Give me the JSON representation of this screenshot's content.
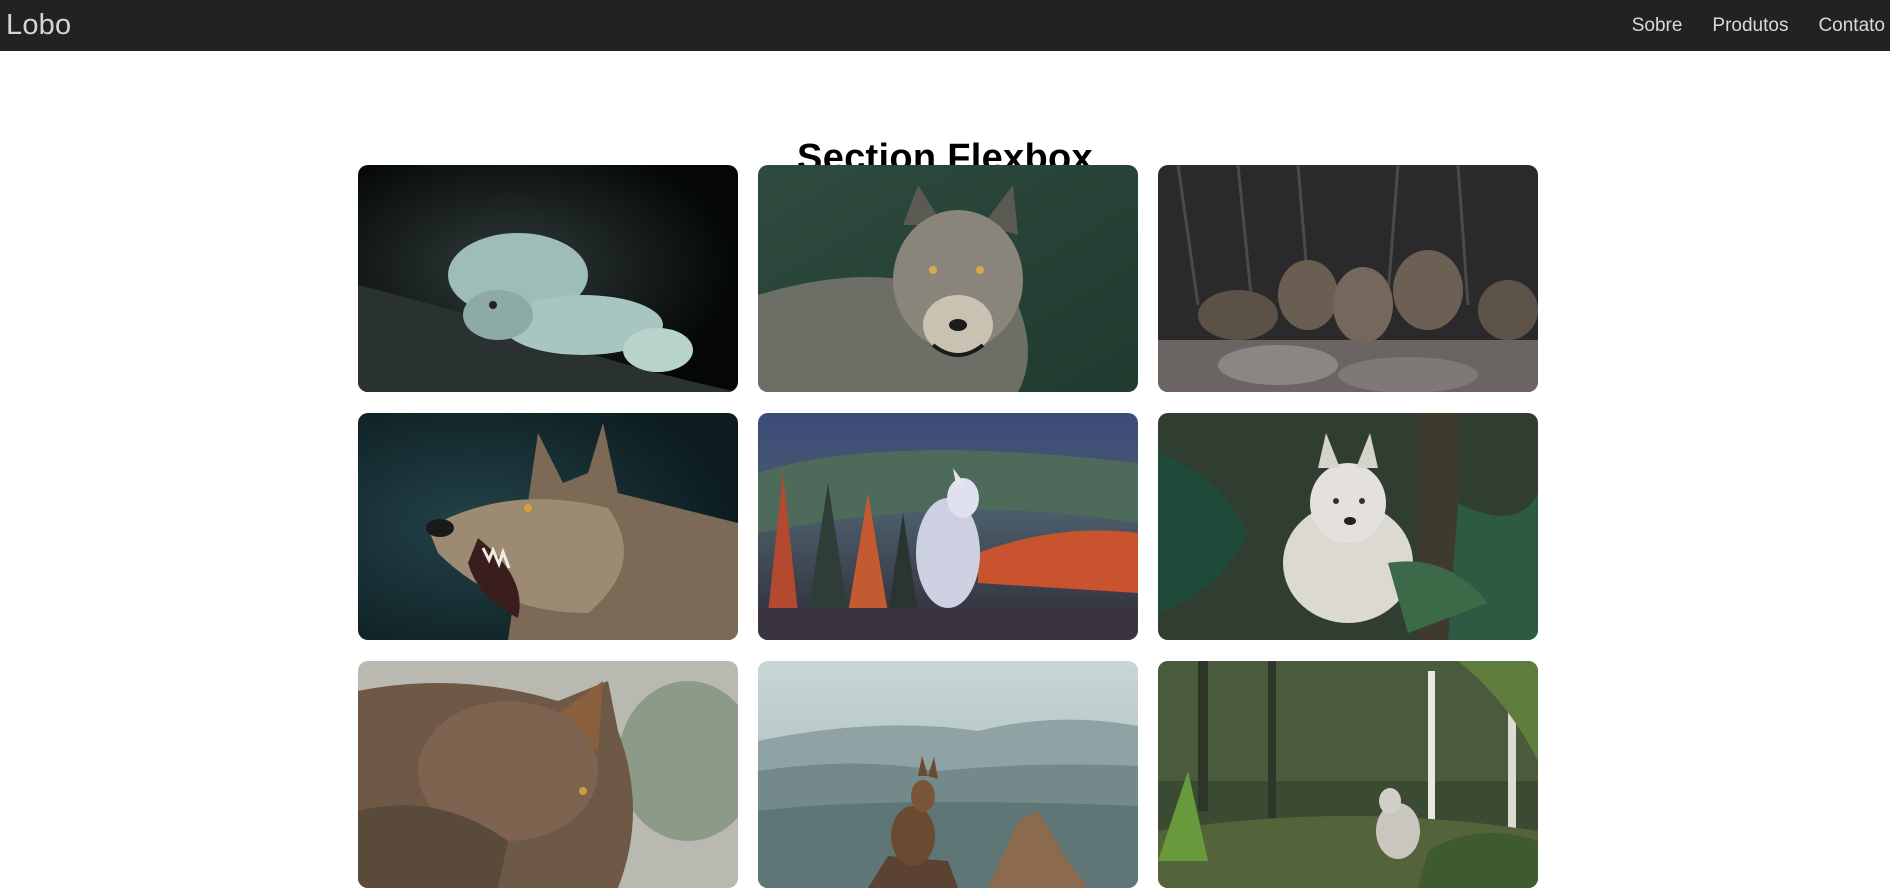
{
  "navbar": {
    "brand": "Lobo",
    "links": [
      "Sobre",
      "Produtos",
      "Contato"
    ]
  },
  "section": {
    "title": "Section Flexbox"
  },
  "gallery": {
    "images": [
      {
        "icon": "white-wolf-sleeping-photo"
      },
      {
        "icon": "gray-wolf-portrait-photo"
      },
      {
        "icon": "wolf-pack-rocks-photo"
      },
      {
        "icon": "snarling-wolf-photo"
      },
      {
        "icon": "white-wolf-hillside-photo"
      },
      {
        "icon": "white-wolf-forest-photo"
      },
      {
        "icon": "brown-wolf-closeup-photo"
      },
      {
        "icon": "wolf-on-rock-photo"
      },
      {
        "icon": "wolf-in-woods-photo"
      }
    ]
  },
  "colors": {
    "navbar_bg": "#222222",
    "nav_text": "#d9d9d9",
    "page_bg": "#ffffff"
  }
}
